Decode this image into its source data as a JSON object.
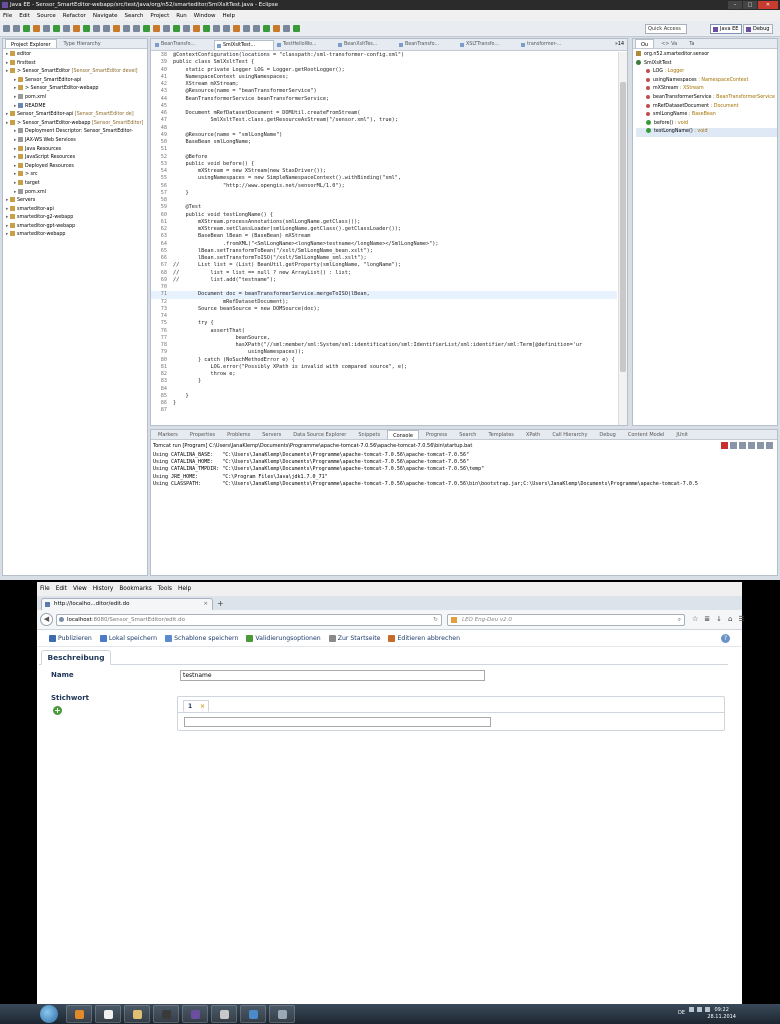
{
  "eclipse": {
    "title": "Java EE - Sensor_SmartEditor-webapp/src/test/java/org/n52/smarteditor/SmlXsltTest.java - Eclipse",
    "menu": [
      "File",
      "Edit",
      "Source",
      "Refactor",
      "Navigate",
      "Search",
      "Project",
      "Run",
      "Window",
      "Help"
    ],
    "quick_access": "Quick Access",
    "perspectives": [
      "Java EE",
      "Debug"
    ],
    "explorer_tabs": [
      "Project Explorer",
      "Type Hierarchy"
    ],
    "tree": [
      {
        "label": "editor",
        "sub": "",
        "indent": 0,
        "kind": "folder"
      },
      {
        "label": "firsttest",
        "sub": "",
        "indent": 0,
        "kind": "folder"
      },
      {
        "label": "> Sensor_SmartEditor",
        "sub": " [Sensor_SmartEditor devel]",
        "indent": 0,
        "kind": "folder"
      },
      {
        "label": "Sensor_SmartEditor-api",
        "sub": "",
        "indent": 1,
        "kind": "folder"
      },
      {
        "label": "> Sensor_SmartEditor-webapp",
        "sub": "",
        "indent": 1,
        "kind": "folder"
      },
      {
        "label": "pom.xml",
        "sub": "",
        "indent": 1,
        "kind": "cfg"
      },
      {
        "label": "README",
        "sub": "",
        "indent": 1,
        "kind": "file"
      },
      {
        "label": "Sensor_SmartEditor-api",
        "sub": " [Sensor_SmartEditor de]",
        "indent": 0,
        "kind": "folder"
      },
      {
        "label": "> Sensor_SmartEditor-webapp",
        "sub": " [Sensor_SmartEditor]",
        "indent": 0,
        "kind": "folder"
      },
      {
        "label": "Deployment Descriptor: Sensor_SmartEditor-",
        "sub": "",
        "indent": 1,
        "kind": "cfg"
      },
      {
        "label": "JAX-WS Web Services",
        "sub": "",
        "indent": 1,
        "kind": "cfg"
      },
      {
        "label": "Java Resources",
        "sub": "",
        "indent": 1,
        "kind": "folder"
      },
      {
        "label": "JavaScript Resources",
        "sub": "",
        "indent": 1,
        "kind": "folder"
      },
      {
        "label": "Deployed Resources",
        "sub": "",
        "indent": 1,
        "kind": "folder"
      },
      {
        "label": "> src",
        "sub": "",
        "indent": 1,
        "kind": "folder"
      },
      {
        "label": "target",
        "sub": "",
        "indent": 1,
        "kind": "folder"
      },
      {
        "label": "pom.xml",
        "sub": "",
        "indent": 1,
        "kind": "cfg"
      },
      {
        "label": "Servers",
        "sub": "",
        "indent": 0,
        "kind": "folder"
      },
      {
        "label": "smarteditor-api",
        "sub": "",
        "indent": 0,
        "kind": "folder"
      },
      {
        "label": "smarteditor-g2-webapp",
        "sub": "",
        "indent": 0,
        "kind": "folder"
      },
      {
        "label": "smarteditor-gpt-webapp",
        "sub": "",
        "indent": 0,
        "kind": "folder"
      },
      {
        "label": "smarteditor-webapp",
        "sub": "",
        "indent": 0,
        "kind": "folder"
      }
    ],
    "editor_tabs": [
      "BeanTransfo...",
      "SmlXsltTest...",
      "TestHelloWo...",
      "BeanXsltTes...",
      "BeanTransfo...",
      "XSLTTransfo...",
      "transformer-..."
    ],
    "editor_tab_overflow": "»14",
    "code": [
      {
        "n": "38",
        "t": "@ContextConfiguration(locations = \"classpath:/sml-transformer-config.xml\")",
        "hl": false
      },
      {
        "n": "39",
        "t": "public class SmlXsltTest {",
        "hl": false
      },
      {
        "n": "40",
        "t": "    static private Logger LOG = Logger.getRootLogger();",
        "hl": false
      },
      {
        "n": "41",
        "t": "    NamespaceContext usingNamespaces;",
        "hl": false
      },
      {
        "n": "42",
        "t": "    XStream mXStream;",
        "hl": false
      },
      {
        "n": "43",
        "t": "    @Resource(name = \"beanTransformerService\")",
        "hl": false
      },
      {
        "n": "44",
        "t": "    BeanTransformerService beanTransformerService;",
        "hl": false
      },
      {
        "n": "45",
        "t": "",
        "hl": false
      },
      {
        "n": "46",
        "t": "    Document mRefDatasetDocument = DOMUtil.createFromStream(",
        "hl": false
      },
      {
        "n": "47",
        "t": "            SmlXsltTest.class.getResourceAsStream(\"/sensor.xml\"), true);",
        "hl": false
      },
      {
        "n": "48",
        "t": "",
        "hl": false
      },
      {
        "n": "49",
        "t": "    @Resource(name = \"smlLongName\")",
        "hl": false
      },
      {
        "n": "50",
        "t": "    BaseBean smlLongName;",
        "hl": false
      },
      {
        "n": "51",
        "t": "",
        "hl": false
      },
      {
        "n": "52",
        "t": "    @Before",
        "hl": false
      },
      {
        "n": "53",
        "t": "    public void before() {",
        "hl": false
      },
      {
        "n": "54",
        "t": "        mXStream = new XStream(new StaxDriver());",
        "hl": false
      },
      {
        "n": "55",
        "t": "        usingNamespaces = new SimpleNamespaceContext().withBinding(\"sml\",",
        "hl": false
      },
      {
        "n": "56",
        "t": "                \"http://www.opengis.net/sensorML/1.0\");",
        "hl": false
      },
      {
        "n": "57",
        "t": "    }",
        "hl": false
      },
      {
        "n": "58",
        "t": "",
        "hl": false
      },
      {
        "n": "59",
        "t": "    @Test",
        "hl": false
      },
      {
        "n": "60",
        "t": "    public void testLongName() {",
        "hl": false
      },
      {
        "n": "61",
        "t": "        mXStream.processAnnotations(smlLongName.getClass());",
        "hl": false
      },
      {
        "n": "62",
        "t": "        mXStream.setClassLoader(smlLongName.getClass().getClassLoader());",
        "hl": false
      },
      {
        "n": "63",
        "t": "        BaseBean lBean = (BaseBean) mXStream",
        "hl": false
      },
      {
        "n": "64",
        "t": "                .fromXML(\"<SmlLongName><longName>testname</longName></SmlLongName>\");",
        "hl": false
      },
      {
        "n": "65",
        "t": "        lBean.setTransformToBean(\"/xslt/SmlLongName_bean.xslt\");",
        "hl": false
      },
      {
        "n": "66",
        "t": "        lBean.setTransformToISO(\"/xslt/SmlLongName_sml.xslt\");",
        "hl": false
      },
      {
        "n": "67",
        "t": "//      List list = (List) BeanUtil.getProperty(smlLongName, \"longName\");",
        "hl": false
      },
      {
        "n": "68",
        "t": "//          list = list == null ? new ArrayList() : list;",
        "hl": false
      },
      {
        "n": "69",
        "t": "//          list.add(\"testname\");",
        "hl": false
      },
      {
        "n": "70",
        "t": "",
        "hl": false
      },
      {
        "n": "71",
        "t": "        Document doc = beanTransformerService.mergeToISO(lBean,",
        "hl": true
      },
      {
        "n": "72",
        "t": "                mRefDatasetDocument);",
        "hl": false
      },
      {
        "n": "73",
        "t": "        Source beanSource = new DOMSource(doc);",
        "hl": false
      },
      {
        "n": "74",
        "t": "",
        "hl": false
      },
      {
        "n": "75",
        "t": "        try {",
        "hl": false
      },
      {
        "n": "76",
        "t": "            assertThat(",
        "hl": false
      },
      {
        "n": "77",
        "t": "                    beanSource,",
        "hl": false
      },
      {
        "n": "78",
        "t": "                    hasXPath(\"//sml:member/sml:System/sml:identification/sml:IdentifierList/sml:identifier/sml:Term[@definition='ur",
        "hl": false
      },
      {
        "n": "79",
        "t": "                        usingNamespaces));",
        "hl": false
      },
      {
        "n": "80",
        "t": "        } catch (NoSuchMethodError e) {",
        "hl": false
      },
      {
        "n": "81",
        "t": "            LOG.error(\"Possibly XPath is invalid with compared source\", e);",
        "hl": false
      },
      {
        "n": "82",
        "t": "            throw e;",
        "hl": false
      },
      {
        "n": "83",
        "t": "        }",
        "hl": false
      },
      {
        "n": "84",
        "t": "",
        "hl": false
      },
      {
        "n": "85",
        "t": "    }",
        "hl": false
      },
      {
        "n": "86",
        "t": "}",
        "hl": false
      },
      {
        "n": "87",
        "t": "",
        "hl": false
      }
    ],
    "outline_tabs": [
      "Ou",
      "<> Va",
      "Ta"
    ],
    "outline": [
      {
        "label": "org.n52.smarteditor.sensor",
        "type": "",
        "kind": "pkg",
        "indent": 0
      },
      {
        "label": "SmlXsltTest",
        "type": "",
        "kind": "cls",
        "indent": 0
      },
      {
        "label": "LOG",
        "type": " : Logger",
        "kind": "fld",
        "indent": 1
      },
      {
        "label": "usingNamespaces",
        "type": " : NamespaceContext",
        "kind": "fld",
        "indent": 1
      },
      {
        "label": "mXStream",
        "type": " : XStream",
        "kind": "fld",
        "indent": 1
      },
      {
        "label": "beanTransformerService",
        "type": " : BeanTransformerService",
        "kind": "fld",
        "indent": 1
      },
      {
        "label": "mRefDatasetDocument",
        "type": " : Document",
        "kind": "fld",
        "indent": 1
      },
      {
        "label": "smlLongName",
        "type": " : BaseBean",
        "kind": "fld",
        "indent": 1
      },
      {
        "label": "before()",
        "type": " : void",
        "kind": "mth",
        "indent": 1
      },
      {
        "label": "testLongName()",
        "type": " : void",
        "kind": "mth",
        "indent": 1
      }
    ],
    "console_tabs": [
      "Markers",
      "Properties",
      "Problems",
      "Servers",
      "Data Source Explorer",
      "Snippets",
      "Console",
      "Progress",
      "Search",
      "Templates",
      "XPath",
      "Call Hierarchy",
      "Debug",
      "Content Model",
      "JUnit"
    ],
    "console_title": "Tomcat run [Program] C:\\Users\\JanaKlemp\\Documents\\Programme\\apache-tomcat-7.0.56\\apache-tomcat-7.0.56\\bin\\startup.bat",
    "console_lines": [
      "Using CATALINA_BASE:   \"C:\\Users\\JanaKlemp\\Documents\\Programme\\apache-tomcat-7.0.56\\apache-tomcat-7.0.56\"",
      "Using CATALINA_HOME:   \"C:\\Users\\JanaKlemp\\Documents\\Programme\\apache-tomcat-7.0.56\\apache-tomcat-7.0.56\"",
      "Using CATALINA_TMPDIR: \"C:\\Users\\JanaKlemp\\Documents\\Programme\\apache-tomcat-7.0.56\\apache-tomcat-7.0.56\\temp\"",
      "Using JRE_HOME:        \"C:\\Program Files\\Java\\jdk1.7.0_71\"",
      "Using CLASSPATH:       \"C:\\Users\\JanaKlemp\\Documents\\Programme\\apache-tomcat-7.0.56\\apache-tomcat-7.0.56\\bin\\bootstrap.jar;C:\\Users\\JanaKlemp\\Documents\\Programme\\apache-tomcat-7.0.5"
    ]
  },
  "firefox": {
    "menu": [
      "File",
      "Edit",
      "View",
      "History",
      "Bookmarks",
      "Tools",
      "Help"
    ],
    "tab_title": "http://localho...ditor/edit.do",
    "url_host": "localhost",
    "url_path": ":8080/Sensor_SmartEditor/edit.do",
    "search_placeholder": "LEO Eng-Deu v2.0",
    "app_toolbar": [
      {
        "label": "Publizieren",
        "color": "#3a6ab0"
      },
      {
        "label": "Lokal speichern",
        "color": "#4a7ac8"
      },
      {
        "label": "Schablone speichern",
        "color": "#5a8ad0"
      },
      {
        "label": "Validierungsoptionen",
        "color": "#4a9a3a"
      },
      {
        "label": "Zur Startseite",
        "color": "#8a8a8a"
      },
      {
        "label": "Editieren abbrechen",
        "color": "#c86a2a"
      }
    ],
    "section_tab": "Beschreibung",
    "name_label": "Name",
    "name_value": "testname",
    "keyword_label": "Stichwort",
    "keyword_tab": "1",
    "keyword_delete": "×",
    "help": "?"
  },
  "taskbar": {
    "lang": "DE",
    "time": "09:22",
    "date": "28.11.2014"
  }
}
